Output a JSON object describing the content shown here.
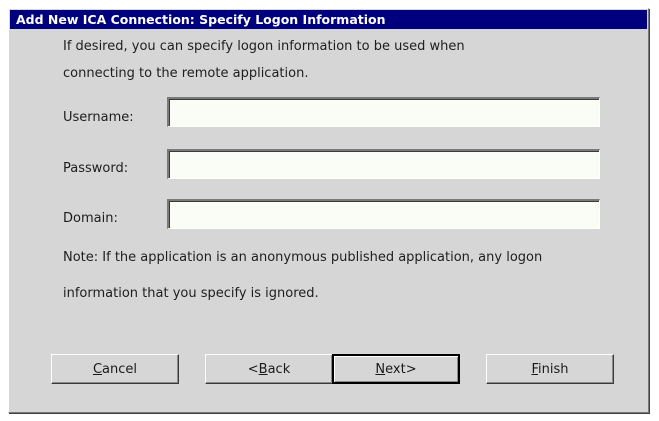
{
  "dialog": {
    "title": "Add New ICA Connection: Specify Logon Information"
  },
  "intro": {
    "line1": "If desired, you can specify logon information to be used when",
    "line2": "connecting to the remote application."
  },
  "fields": {
    "username": {
      "label": "Username:",
      "value": ""
    },
    "password": {
      "label": "Password:",
      "value": ""
    },
    "domain": {
      "label": "Domain:",
      "value": ""
    }
  },
  "note": {
    "line1": "Note: If the application is an anonymous published application, any logon",
    "line2": "information that you specify is ignored."
  },
  "buttons": {
    "cancel": {
      "pre": "",
      "mnemonic": "C",
      "post": "ancel"
    },
    "back": {
      "pre": "<",
      "mnemonic": "B",
      "post": "ack"
    },
    "next": {
      "pre": "",
      "mnemonic": "N",
      "post": "ext>"
    },
    "finish": {
      "pre": "",
      "mnemonic": "F",
      "post": "inish"
    }
  },
  "colors": {
    "title_bar": "#00007f",
    "dialog_bg": "#d6d6d6",
    "field_bg": "#f9fdf5"
  }
}
